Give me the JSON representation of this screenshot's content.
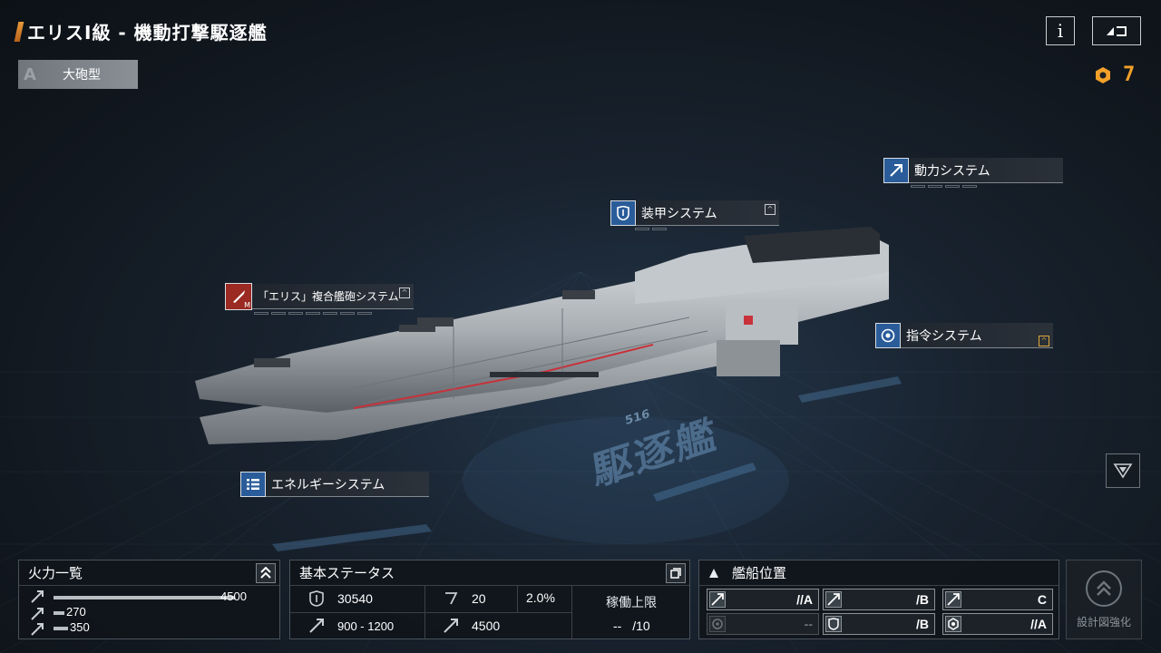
{
  "header": {
    "title": "エリスI級 - 機動打撃駆逐艦",
    "type_letter": "A",
    "type_label": "大砲型",
    "info_label": "i",
    "back_icon": "return-icon"
  },
  "currency": {
    "icon": "gear-badge-icon",
    "value": "7",
    "color": "#f2a12a"
  },
  "systems": {
    "power": "動力システム",
    "armor": "装甲システム",
    "cannon": "「エリス」複合艦砲システム",
    "cannon_badge": "M",
    "command": "指令システム",
    "energy": "エネルギーシステム"
  },
  "decal": {
    "number": "516",
    "text": "駆逐艦"
  },
  "firepower": {
    "title": "火力一覧",
    "rows": [
      {
        "value": "4500",
        "ratio": 1.0
      },
      {
        "value": "270",
        "ratio": 0.06
      },
      {
        "value": "350",
        "ratio": 0.078
      }
    ]
  },
  "base_status": {
    "title": "基本ステータス",
    "hp": "30540",
    "speed_stat": "20",
    "evasion": "2.0%",
    "attack_range": "900 - 1200",
    "range_value": "4500",
    "operation_label": "稼働上限",
    "operation_value": "--",
    "operation_max": "/10"
  },
  "positions": {
    "title": "艦船位置",
    "cells": [
      {
        "icon": "attack-icon",
        "text": "//A",
        "dim": false
      },
      {
        "icon": "attack-icon",
        "text": "/B",
        "dim": false
      },
      {
        "icon": "attack-icon",
        "text": "C",
        "dim": false
      },
      {
        "icon": "target-icon",
        "text": "--",
        "dim": true
      },
      {
        "icon": "shield-icon",
        "text": "/B",
        "dim": false
      },
      {
        "icon": "gear-icon",
        "text": "//A",
        "dim": false
      }
    ]
  },
  "enhance": {
    "label": "設計図強化"
  }
}
